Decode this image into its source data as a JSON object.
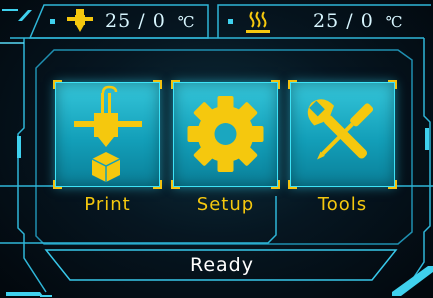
{
  "header": {
    "nozzle": {
      "icon": "nozzle-heater-icon",
      "current": "25",
      "separator": "/",
      "target": "0",
      "unit": "℃"
    },
    "bed": {
      "icon": "heated-bed-icon",
      "current": "25",
      "separator": "/",
      "target": "0",
      "unit": "℃"
    }
  },
  "menu": {
    "tiles": [
      {
        "label": "Print",
        "icon": "print-icon"
      },
      {
        "label": "Setup",
        "icon": "gear-icon"
      },
      {
        "label": "Tools",
        "icon": "tools-icon"
      }
    ]
  },
  "status": {
    "text": "Ready"
  },
  "colors": {
    "accent": "#3fd1ee",
    "tile": "#139fb9",
    "icon": "#f5c80e",
    "label": "#f5c80e",
    "background": "#061621"
  }
}
